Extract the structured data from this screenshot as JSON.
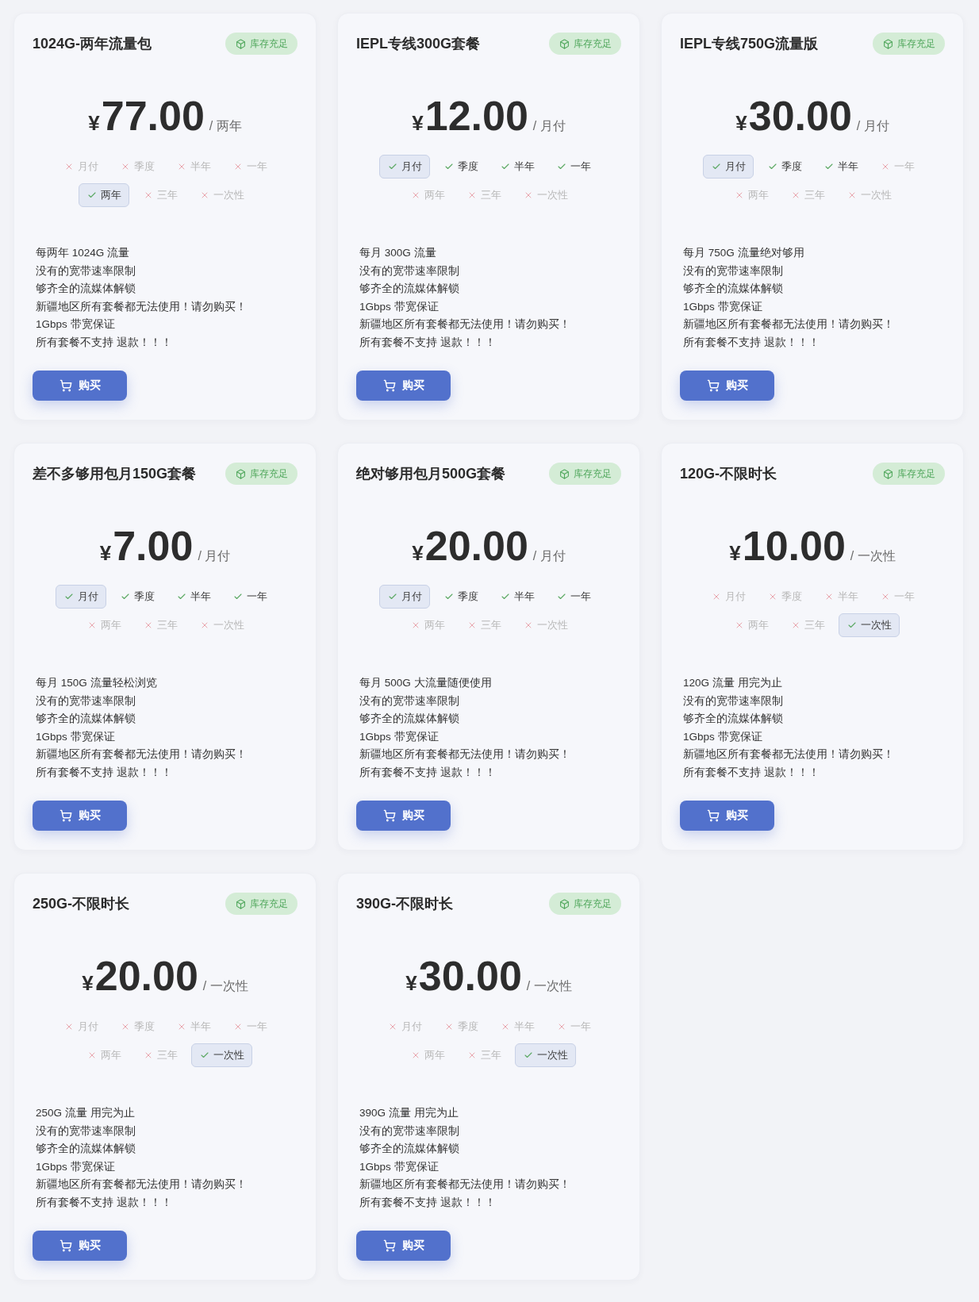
{
  "plans": [
    {
      "name": "1024G-两年流量包",
      "badge": "库存充足",
      "currency": "¥",
      "price": "77.00",
      "per": "/ 两年",
      "options": [
        {
          "label": "月付",
          "available": false,
          "selected": false
        },
        {
          "label": "季度",
          "available": false,
          "selected": false
        },
        {
          "label": "半年",
          "available": false,
          "selected": false
        },
        {
          "label": "一年",
          "available": false,
          "selected": false
        },
        {
          "label": "两年",
          "available": true,
          "selected": true
        },
        {
          "label": "三年",
          "available": false,
          "selected": false
        },
        {
          "label": "一次性",
          "available": false,
          "selected": false
        }
      ],
      "features": [
        "每两年 1024G 流量",
        "没有的宽带速率限制",
        "够齐全的流媒体解锁",
        "新疆地区所有套餐都无法使用！请勿购买！",
        "1Gbps 带宽保证",
        "所有套餐不支持 退款！！！"
      ],
      "buy_label": "购买"
    },
    {
      "name": "IEPL专线300G套餐",
      "badge": "库存充足",
      "currency": "¥",
      "price": "12.00",
      "per": "/ 月付",
      "options": [
        {
          "label": "月付",
          "available": true,
          "selected": true
        },
        {
          "label": "季度",
          "available": true,
          "selected": false
        },
        {
          "label": "半年",
          "available": true,
          "selected": false
        },
        {
          "label": "一年",
          "available": true,
          "selected": false
        },
        {
          "label": "两年",
          "available": false,
          "selected": false
        },
        {
          "label": "三年",
          "available": false,
          "selected": false
        },
        {
          "label": "一次性",
          "available": false,
          "selected": false
        }
      ],
      "features": [
        "每月 300G 流量",
        "没有的宽带速率限制",
        "够齐全的流媒体解锁",
        "1Gbps 带宽保证",
        "新疆地区所有套餐都无法使用！请勿购买！",
        "所有套餐不支持 退款！！！"
      ],
      "buy_label": "购买"
    },
    {
      "name": "IEPL专线750G流量版",
      "badge": "库存充足",
      "currency": "¥",
      "price": "30.00",
      "per": "/ 月付",
      "options": [
        {
          "label": "月付",
          "available": true,
          "selected": true
        },
        {
          "label": "季度",
          "available": true,
          "selected": false
        },
        {
          "label": "半年",
          "available": true,
          "selected": false
        },
        {
          "label": "一年",
          "available": false,
          "selected": false
        },
        {
          "label": "两年",
          "available": false,
          "selected": false
        },
        {
          "label": "三年",
          "available": false,
          "selected": false
        },
        {
          "label": "一次性",
          "available": false,
          "selected": false
        }
      ],
      "features": [
        "每月 750G 流量绝对够用",
        "没有的宽带速率限制",
        "够齐全的流媒体解锁",
        "1Gbps 带宽保证",
        "新疆地区所有套餐都无法使用！请勿购买！",
        "所有套餐不支持 退款！！！"
      ],
      "buy_label": "购买"
    },
    {
      "name": "差不多够用包月150G套餐",
      "badge": "库存充足",
      "currency": "¥",
      "price": "7.00",
      "per": "/ 月付",
      "options": [
        {
          "label": "月付",
          "available": true,
          "selected": true
        },
        {
          "label": "季度",
          "available": true,
          "selected": false
        },
        {
          "label": "半年",
          "available": true,
          "selected": false
        },
        {
          "label": "一年",
          "available": true,
          "selected": false
        },
        {
          "label": "两年",
          "available": false,
          "selected": false
        },
        {
          "label": "三年",
          "available": false,
          "selected": false
        },
        {
          "label": "一次性",
          "available": false,
          "selected": false
        }
      ],
      "features": [
        "每月 150G 流量轻松浏览",
        "没有的宽带速率限制",
        "够齐全的流媒体解锁",
        "1Gbps 带宽保证",
        "新疆地区所有套餐都无法使用！请勿购买！",
        "所有套餐不支持 退款！！！"
      ],
      "buy_label": "购买"
    },
    {
      "name": "绝对够用包月500G套餐",
      "badge": "库存充足",
      "currency": "¥",
      "price": "20.00",
      "per": "/ 月付",
      "options": [
        {
          "label": "月付",
          "available": true,
          "selected": true
        },
        {
          "label": "季度",
          "available": true,
          "selected": false
        },
        {
          "label": "半年",
          "available": true,
          "selected": false
        },
        {
          "label": "一年",
          "available": true,
          "selected": false
        },
        {
          "label": "两年",
          "available": false,
          "selected": false
        },
        {
          "label": "三年",
          "available": false,
          "selected": false
        },
        {
          "label": "一次性",
          "available": false,
          "selected": false
        }
      ],
      "features": [
        "每月 500G 大流量随便使用",
        "没有的宽带速率限制",
        "够齐全的流媒体解锁",
        "1Gbps 带宽保证",
        "新疆地区所有套餐都无法使用！请勿购买！",
        "所有套餐不支持 退款！！！"
      ],
      "buy_label": "购买"
    },
    {
      "name": "120G-不限时长",
      "badge": "库存充足",
      "currency": "¥",
      "price": "10.00",
      "per": "/ 一次性",
      "options": [
        {
          "label": "月付",
          "available": false,
          "selected": false
        },
        {
          "label": "季度",
          "available": false,
          "selected": false
        },
        {
          "label": "半年",
          "available": false,
          "selected": false
        },
        {
          "label": "一年",
          "available": false,
          "selected": false
        },
        {
          "label": "两年",
          "available": false,
          "selected": false
        },
        {
          "label": "三年",
          "available": false,
          "selected": false
        },
        {
          "label": "一次性",
          "available": true,
          "selected": true
        }
      ],
      "features": [
        "120G 流量 用完为止",
        "没有的宽带速率限制",
        "够齐全的流媒体解锁",
        "1Gbps 带宽保证",
        "新疆地区所有套餐都无法使用！请勿购买！",
        "所有套餐不支持 退款！！！"
      ],
      "buy_label": "购买"
    },
    {
      "name": "250G-不限时长",
      "badge": "库存充足",
      "currency": "¥",
      "price": "20.00",
      "per": "/ 一次性",
      "options": [
        {
          "label": "月付",
          "available": false,
          "selected": false
        },
        {
          "label": "季度",
          "available": false,
          "selected": false
        },
        {
          "label": "半年",
          "available": false,
          "selected": false
        },
        {
          "label": "一年",
          "available": false,
          "selected": false
        },
        {
          "label": "两年",
          "available": false,
          "selected": false
        },
        {
          "label": "三年",
          "available": false,
          "selected": false
        },
        {
          "label": "一次性",
          "available": true,
          "selected": true
        }
      ],
      "features": [
        "250G 流量 用完为止",
        "没有的宽带速率限制",
        "够齐全的流媒体解锁",
        "1Gbps 带宽保证",
        "新疆地区所有套餐都无法使用！请勿购买！",
        "所有套餐不支持 退款！！！"
      ],
      "buy_label": "购买"
    },
    {
      "name": "390G-不限时长",
      "badge": "库存充足",
      "currency": "¥",
      "price": "30.00",
      "per": "/ 一次性",
      "options": [
        {
          "label": "月付",
          "available": false,
          "selected": false
        },
        {
          "label": "季度",
          "available": false,
          "selected": false
        },
        {
          "label": "半年",
          "available": false,
          "selected": false
        },
        {
          "label": "一年",
          "available": false,
          "selected": false
        },
        {
          "label": "两年",
          "available": false,
          "selected": false
        },
        {
          "label": "三年",
          "available": false,
          "selected": false
        },
        {
          "label": "一次性",
          "available": true,
          "selected": true
        }
      ],
      "features": [
        "390G 流量 用完为止",
        "没有的宽带速率限制",
        "够齐全的流媒体解锁",
        "1Gbps 带宽保证",
        "新疆地区所有套餐都无法使用！请勿购买！",
        "所有套餐不支持 退款！！！"
      ],
      "buy_label": "购买"
    }
  ]
}
